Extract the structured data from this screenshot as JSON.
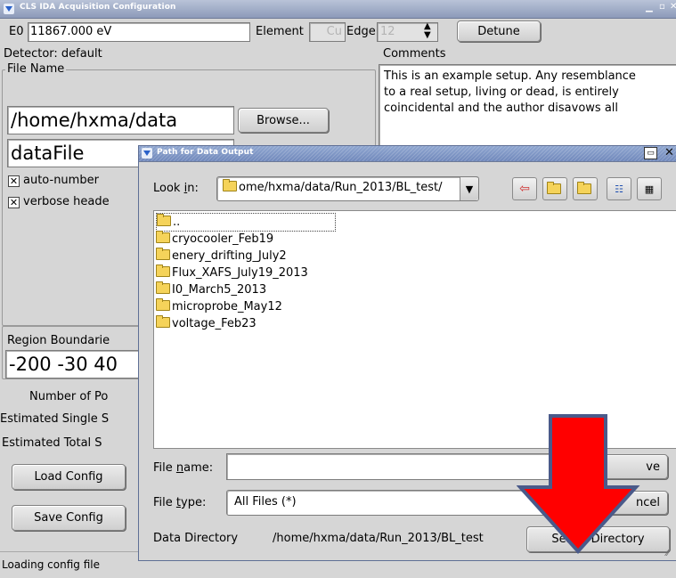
{
  "main": {
    "title": "CLS IDA Acquisition Configuration",
    "e0_label": "E0",
    "e0_value": "11867.000 eV",
    "element_label": "Element",
    "element_value": "Cu",
    "edge_label": "Edge",
    "edge_value": "12",
    "detune_label": "Detune",
    "detector_label": "Detector: default",
    "comments_label": "Comments",
    "comments_text_1": "This is an example setup. Any resemblance",
    "comments_text_2": "to a real setup, living or dead, is entirely",
    "comments_text_3": "coincidental and the author disavows all",
    "file_name_group": "File Name",
    "path_value": "/home/hxma/data",
    "browse_label": "Browse...",
    "datafile_value": "dataFile",
    "auto_number_label": "auto-number",
    "verbose_label": "verbose heade",
    "region_label": "Region Boundarie",
    "region_value": "-200 -30 40",
    "number_points_label": "Number of Po",
    "est_single_label": "Estimated Single S",
    "est_total_label": "Estimated Total S",
    "load_config_label": "Load Config",
    "save_config_label": "Save Config",
    "status_text": "Loading config file"
  },
  "dialog": {
    "title": "Path for Data Output",
    "look_in_label_pre": "Look ",
    "look_in_label_u": "i",
    "look_in_label_post": "n:",
    "look_in_value": "ome/hxma/data/Run_2013/BL_test/",
    "files": [
      "..",
      "cryocooler_Feb19",
      "enery_drifting_July2",
      "Flux_XAFS_July19_2013",
      "I0_March5_2013",
      "microprobe_May12",
      "voltage_Feb23"
    ],
    "file_name_label_pre": "File ",
    "file_name_label_u": "n",
    "file_name_label_post": "ame:",
    "file_name_value": "",
    "save_label": "ve",
    "file_type_label_pre": "File ",
    "file_type_label_u": "t",
    "file_type_label_post": "ype:",
    "file_type_value": "All Files (*)",
    "cancel_label": "ncel",
    "data_dir_label": "Data Directory",
    "data_dir_value": "/home/hxma/data/Run_2013/BL_test",
    "select_dir_label": "Select Directory"
  },
  "annotation": {
    "arrow_color": "#ff0000",
    "arrow_outline": "#4a5a8a"
  }
}
